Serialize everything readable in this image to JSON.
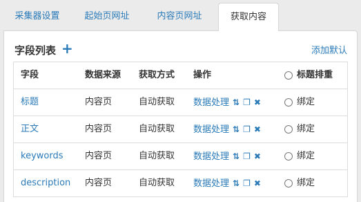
{
  "tabs": [
    {
      "label": "采集器设置"
    },
    {
      "label": "起始页网址"
    },
    {
      "label": "内容页网址"
    },
    {
      "label": "获取内容"
    }
  ],
  "panel": {
    "title": "字段列表",
    "add_icon": "plus-icon",
    "add_default": "添加默认"
  },
  "table": {
    "headers": {
      "field": "字段",
      "source": "数据来源",
      "method": "获取方式",
      "action": "操作",
      "dedupe": "标题排重"
    },
    "rows": [
      {
        "field": "标题",
        "source": "内容页",
        "method": "自动获取",
        "action": "数据处理",
        "bind": "绑定"
      },
      {
        "field": "正文",
        "source": "内容页",
        "method": "自动获取",
        "action": "数据处理",
        "bind": "绑定"
      },
      {
        "field": "keywords",
        "source": "内容页",
        "method": "自动获取",
        "action": "数据处理",
        "bind": "绑定"
      },
      {
        "field": "description",
        "source": "内容页",
        "method": "自动获取",
        "action": "数据处理",
        "bind": "绑定"
      }
    ]
  },
  "colors": {
    "accent": "#2a7ab8"
  }
}
